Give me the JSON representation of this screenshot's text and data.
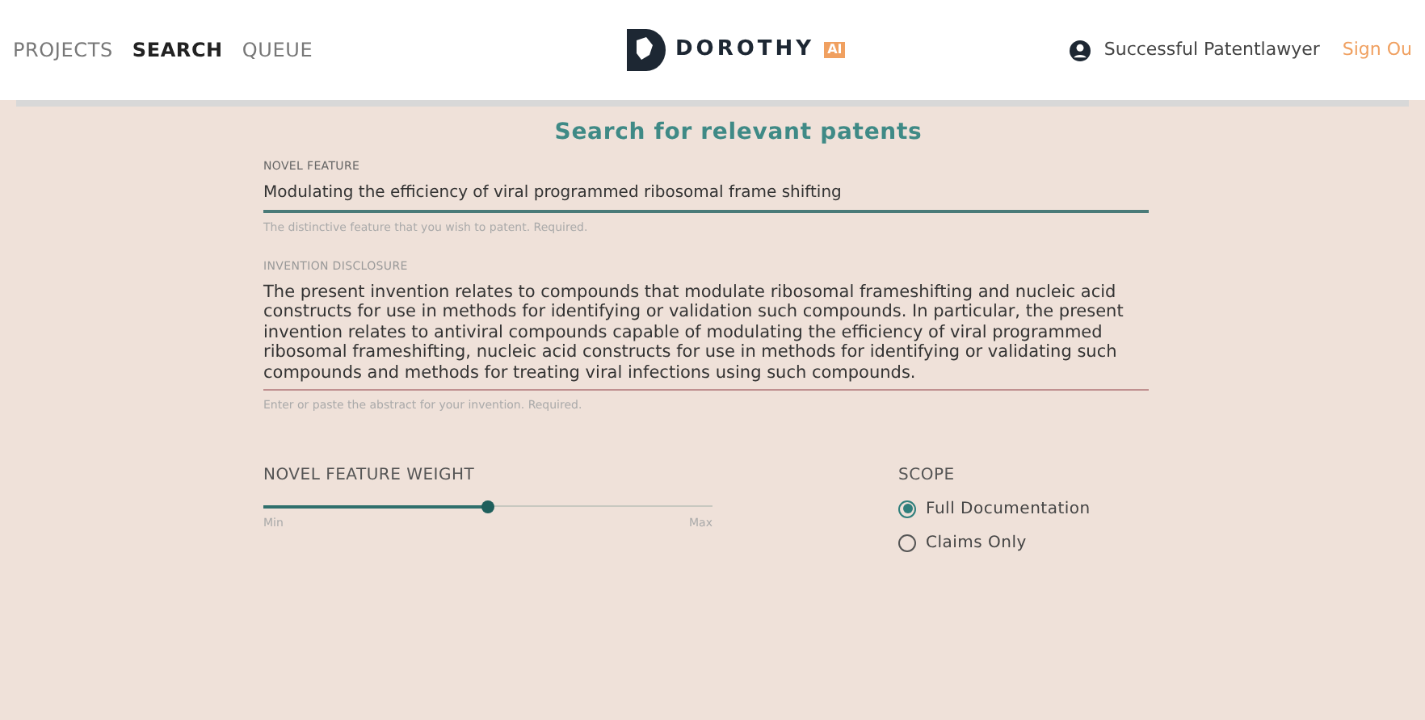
{
  "nav": [
    {
      "label": "PROJECTS",
      "selected": false
    },
    {
      "label": "SEARCH",
      "selected": true
    },
    {
      "label": "QUEUE",
      "selected": false
    }
  ],
  "logo": {
    "name": "DOROTHY",
    "badge": "AI"
  },
  "user": {
    "name": "Successful Patentlawyer",
    "sign_out": "Sign Ou"
  },
  "title": "Search for relevant patents",
  "novel_feature": {
    "label": "NOVEL FEATURE",
    "value": "Modulating the efficiency of viral programmed ribosomal frame shifting",
    "helper": "The distinctive feature that you wish to patent. Required."
  },
  "disclosure": {
    "label": "INVENTION DISCLOSURE",
    "value": "The present invention relates to compounds that modulate ribosomal frameshifting and nucleic acid constructs for use in methods for identifying or validation such compounds. In particular, the present invention relates to antiviral compounds capable of modulating the efficiency of viral programmed ribosomal frameshifting, nucleic acid constructs for use in methods for identifying or validating such compounds and methods for treating viral infections using such compounds.",
    "helper": "Enter or paste the abstract for your invention. Required."
  },
  "weight": {
    "label": "NOVEL FEATURE WEIGHT",
    "level": 0.5,
    "min": "Min",
    "max": "Max"
  },
  "scope": {
    "label": "SCOPE",
    "options": [
      {
        "label": "Full Documentation",
        "selected": true
      },
      {
        "label": "Claims Only",
        "selected": false
      }
    ]
  }
}
